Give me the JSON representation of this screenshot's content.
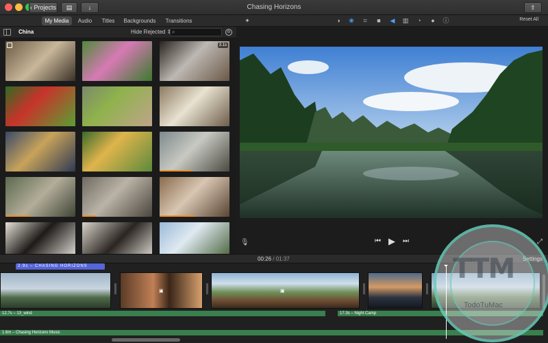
{
  "window": {
    "title": "Chasing Horizons"
  },
  "toolbar": {
    "projects_label": "Projects",
    "share_icon": "share-icon"
  },
  "browser_tabs": [
    {
      "label": "My Media",
      "active": true
    },
    {
      "label": "Audio",
      "active": false
    },
    {
      "label": "Titles",
      "active": false
    },
    {
      "label": "Backgrounds",
      "active": false
    },
    {
      "label": "Transitions",
      "active": false
    }
  ],
  "browser": {
    "event_name": "China",
    "filter_label": "Hide Rejected",
    "search_placeholder": "",
    "clips": [
      {
        "subject": "moped plate",
        "duration": "",
        "used": 0
      },
      {
        "subject": "lotus flower",
        "duration": "",
        "used": 0
      },
      {
        "subject": "steam pot",
        "duration": "3.1s",
        "used": 0
      },
      {
        "subject": "chili peppers",
        "duration": "",
        "used": 0
      },
      {
        "subject": "vegetables",
        "duration": "",
        "used": 0
      },
      {
        "subject": "dumplings",
        "duration": "",
        "used": 0
      },
      {
        "subject": "hands grapes",
        "duration": "",
        "used": 0
      },
      {
        "subject": "market bowls",
        "duration": "",
        "used": 0
      },
      {
        "subject": "village cyclists",
        "duration": "",
        "used": 0.45
      },
      {
        "subject": "village road",
        "duration": "",
        "used": 0.35
      },
      {
        "subject": "alley walker",
        "duration": "",
        "used": 0.2
      },
      {
        "subject": "family room",
        "duration": "",
        "used": 0.5
      },
      {
        "subject": "calligraphy 1",
        "duration": "",
        "used": 0
      },
      {
        "subject": "calligraphy 2",
        "duration": "",
        "used": 0
      },
      {
        "subject": "tree landscape",
        "duration": "",
        "used": 0
      }
    ]
  },
  "viewer": {
    "reset_label": "Reset All"
  },
  "timeline": {
    "current_time": "00:26",
    "separator": "/",
    "total_time": "01:37",
    "settings_label": "Settings",
    "title_clip": "2.9s – CHASING HORIZONS",
    "audio_tracks": [
      {
        "label": "12.7s – 13_wind"
      },
      {
        "label": "17.3s – Night Camp"
      },
      {
        "label": "1.6m – Chasing Horizons Music"
      }
    ]
  },
  "watermark": {
    "logo_text": "TTM",
    "site": "TodoTuMac"
  },
  "colors": {
    "accent": "#5566d8",
    "audio_green": "#3a7f4e",
    "used_orange": "#f08d1e"
  }
}
